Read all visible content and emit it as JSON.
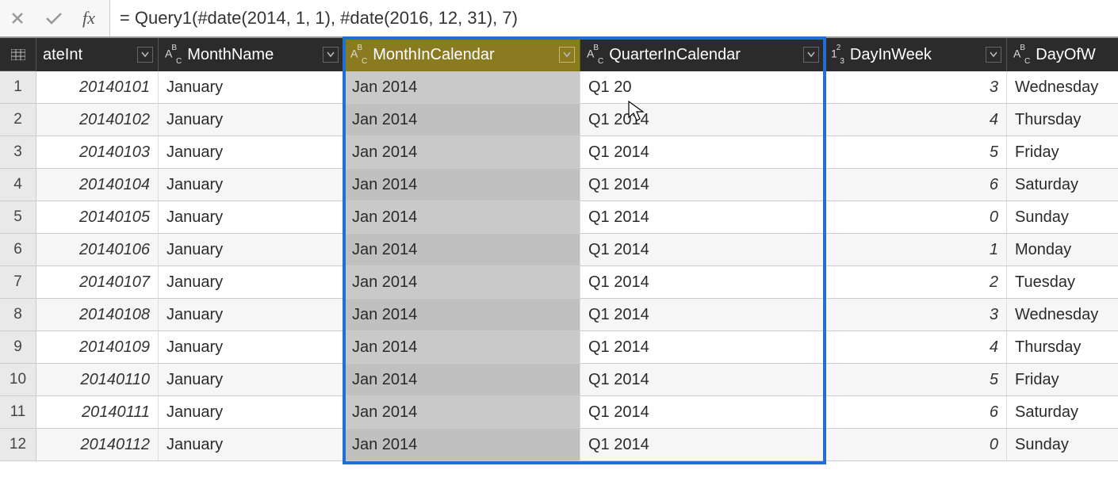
{
  "formula": {
    "fx_label": "fx",
    "value": "= Query1(#date(2014, 1, 1), #date(2016, 12, 31), 7)"
  },
  "columns": {
    "dateint": {
      "name": "ateInt",
      "type": "num"
    },
    "monthname": {
      "name": "MonthName",
      "type": "text"
    },
    "monthincal": {
      "name": "MonthInCalendar",
      "type": "text"
    },
    "quarterincal": {
      "name": "QuarterInCalendar",
      "type": "text"
    },
    "dayinweek": {
      "name": "DayInWeek",
      "type": "num"
    },
    "dayofweek": {
      "name": "DayOfW",
      "type": "text"
    }
  },
  "rows": [
    {
      "n": "1",
      "dateint": "20140101",
      "month": "January",
      "mic": "Jan 2014",
      "qic": "Q1 20",
      "diw": "3",
      "dow": "Wednesday"
    },
    {
      "n": "2",
      "dateint": "20140102",
      "month": "January",
      "mic": "Jan 2014",
      "qic": "Q1 2014",
      "diw": "4",
      "dow": "Thursday"
    },
    {
      "n": "3",
      "dateint": "20140103",
      "month": "January",
      "mic": "Jan 2014",
      "qic": "Q1 2014",
      "diw": "5",
      "dow": "Friday"
    },
    {
      "n": "4",
      "dateint": "20140104",
      "month": "January",
      "mic": "Jan 2014",
      "qic": "Q1 2014",
      "diw": "6",
      "dow": "Saturday"
    },
    {
      "n": "5",
      "dateint": "20140105",
      "month": "January",
      "mic": "Jan 2014",
      "qic": "Q1 2014",
      "diw": "0",
      "dow": "Sunday"
    },
    {
      "n": "6",
      "dateint": "20140106",
      "month": "January",
      "mic": "Jan 2014",
      "qic": "Q1 2014",
      "diw": "1",
      "dow": "Monday"
    },
    {
      "n": "7",
      "dateint": "20140107",
      "month": "January",
      "mic": "Jan 2014",
      "qic": "Q1 2014",
      "diw": "2",
      "dow": "Tuesday"
    },
    {
      "n": "8",
      "dateint": "20140108",
      "month": "January",
      "mic": "Jan 2014",
      "qic": "Q1 2014",
      "diw": "3",
      "dow": "Wednesday"
    },
    {
      "n": "9",
      "dateint": "20140109",
      "month": "January",
      "mic": "Jan 2014",
      "qic": "Q1 2014",
      "diw": "4",
      "dow": "Thursday"
    },
    {
      "n": "10",
      "dateint": "20140110",
      "month": "January",
      "mic": "Jan 2014",
      "qic": "Q1 2014",
      "diw": "5",
      "dow": "Friday"
    },
    {
      "n": "11",
      "dateint": "20140111",
      "month": "January",
      "mic": "Jan 2014",
      "qic": "Q1 2014",
      "diw": "6",
      "dow": "Saturday"
    },
    {
      "n": "12",
      "dateint": "20140112",
      "month": "January",
      "mic": "Jan 2014",
      "qic": "Q1 2014",
      "diw": "0",
      "dow": "Sunday"
    }
  ],
  "colors": {
    "highlight": "#1f6fd6",
    "selected_header": "#8a7a20"
  }
}
